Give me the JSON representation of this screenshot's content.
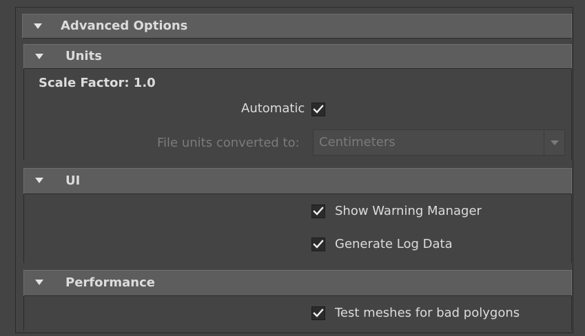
{
  "advanced_options": {
    "title": "Advanced Options",
    "expanded": true
  },
  "units": {
    "title": "Units",
    "expanded": true,
    "scale_factor": "Scale Factor: 1.0",
    "automatic_label": "Automatic",
    "automatic_checked": true,
    "file_units_label": "File units converted to:",
    "file_units_value": "Centimeters",
    "file_units_enabled": false
  },
  "ui": {
    "title": "UI",
    "expanded": true,
    "show_warning_manager_label": "Show Warning Manager",
    "show_warning_manager_checked": true,
    "generate_log_data_label": "Generate Log Data",
    "generate_log_data_checked": true
  },
  "performance": {
    "title": "Performance",
    "expanded": true,
    "test_meshes_label": "Test meshes for bad polygons",
    "test_meshes_checked": true
  },
  "icons": {
    "expand_arrow": "triangle-down-icon",
    "check": "checkmark-icon",
    "dropdown_arrow": "chevron-down-icon"
  },
  "colors": {
    "background": "#444444",
    "header": "#5d5d5d",
    "checkbox_bg": "#2b2b2b",
    "text": "#dcdcdc",
    "disabled_text": "#7b7b7b"
  }
}
